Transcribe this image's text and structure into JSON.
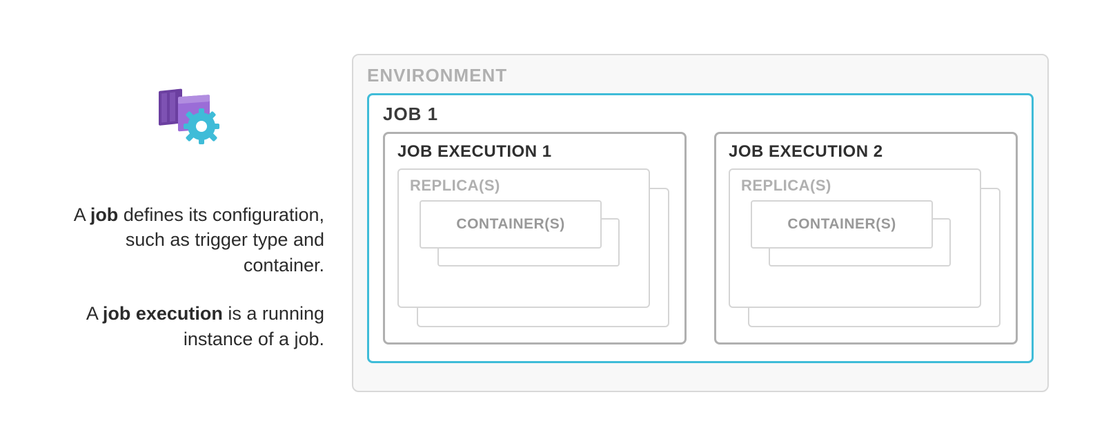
{
  "description": {
    "p1_pre": "A ",
    "p1_bold": "job",
    "p1_post": " defines its configuration, such as trigger type and container.",
    "p2_pre": "A ",
    "p2_bold": "job execution",
    "p2_post": " is a running instance of a job."
  },
  "diagram": {
    "environment_label": "ENVIRONMENT",
    "job_label": "JOB 1",
    "executions": [
      {
        "label": "JOB EXECUTION 1",
        "replica_label": "REPLICA(S)",
        "container_label": "CONTAINER(S)"
      },
      {
        "label": "JOB EXECUTION 2",
        "replica_label": "REPLICA(S)",
        "container_label": "CONTAINER(S)"
      }
    ]
  },
  "icon": {
    "name": "container-app-job-icon",
    "colors": {
      "box_dark": "#6b3fa0",
      "box_light": "#9b6dd7",
      "gear": "#3fbcd8"
    }
  }
}
